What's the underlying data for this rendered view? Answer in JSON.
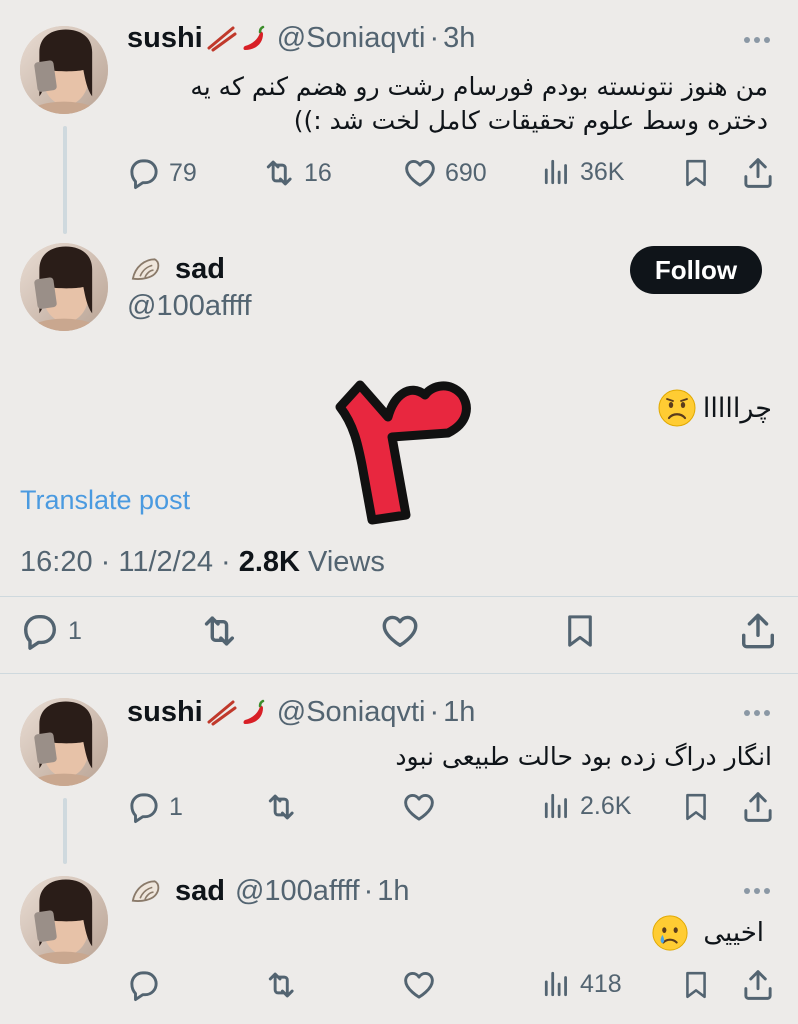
{
  "tweet1": {
    "display_name": "sushi",
    "handle": "@Soniaqvti",
    "time": "3h",
    "text_line1": "من هنوز نتونسته بودم فورسام رشت رو هضم کنم که یه",
    "text_line2": "دختره وسط علوم تحقیقات کامل لخت شد :))",
    "replies": "79",
    "reposts": "16",
    "likes": "690",
    "views": "36K"
  },
  "main": {
    "display_name": "sad",
    "handle": "@100affff",
    "follow_label": "Follow",
    "text": "چرااااا",
    "overlay_numeral": "۳",
    "translate_label": "Translate post",
    "timestamp": "16:20 · 11/2/24 · ",
    "views_count": "2.8K",
    "views_label": " Views",
    "replies": "1"
  },
  "reply1": {
    "display_name": "sushi",
    "handle": "@Soniaqvti",
    "time": "1h",
    "text": "انگار دراگ زده بود حالت طبیعی نبود",
    "replies": "1",
    "views": "2.6K"
  },
  "reply2": {
    "display_name": "sad",
    "handle": "@100affff",
    "time": "1h",
    "text": "اخییی",
    "views": "418"
  },
  "separator": "·",
  "colors": {
    "background": "#edebe9",
    "text": "#0f1419",
    "secondary": "#536471",
    "link": "#4a9ae0",
    "overlay_red": "#e8273f"
  },
  "icons": [
    "reply-icon",
    "repost-icon",
    "like-icon",
    "views-icon",
    "bookmark-icon",
    "share-icon",
    "more-icon",
    "chopsticks-emoji",
    "chili-emoji",
    "shell-emoji",
    "worried-face-emoji",
    "crying-face-emoji"
  ]
}
